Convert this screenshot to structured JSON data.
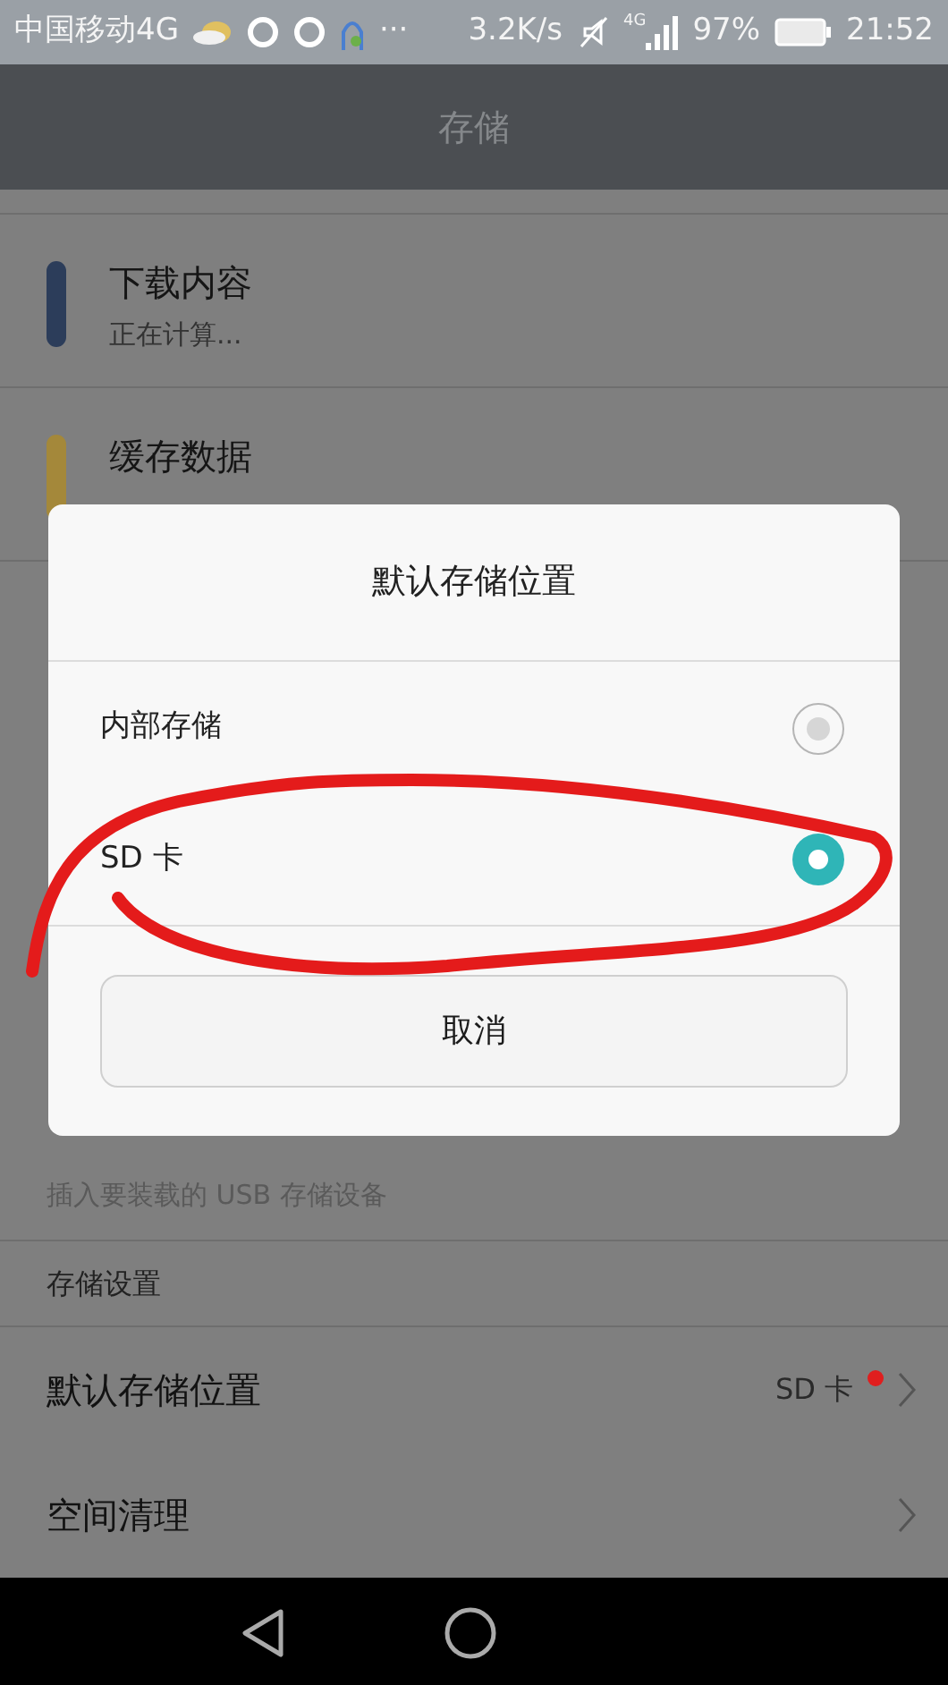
{
  "status_bar": {
    "carrier": "中国移动4G",
    "more": "···",
    "speed": "3.2K/s",
    "network": "4G",
    "battery": "97%",
    "time": "21:52"
  },
  "header": {
    "title": "存储"
  },
  "storage_items": [
    {
      "title": "下载内容",
      "subtitle": "正在计算...",
      "color": "#2c3d5a"
    },
    {
      "title": "缓存数据",
      "color": "#a4883a"
    }
  ],
  "usb_row": {
    "subtitle": "插入要装载的 USB 存储设备"
  },
  "section_header": "存储设置",
  "settings": [
    {
      "title": "默认存储位置",
      "value": "SD 卡",
      "new_dot": true
    },
    {
      "title": "空间清理",
      "new_dot": false
    }
  ],
  "dialog": {
    "title": "默认存储位置",
    "options": [
      {
        "label": "内部存储",
        "selected": false
      },
      {
        "label": "SD 卡",
        "selected": true
      }
    ],
    "cancel": "取消"
  }
}
